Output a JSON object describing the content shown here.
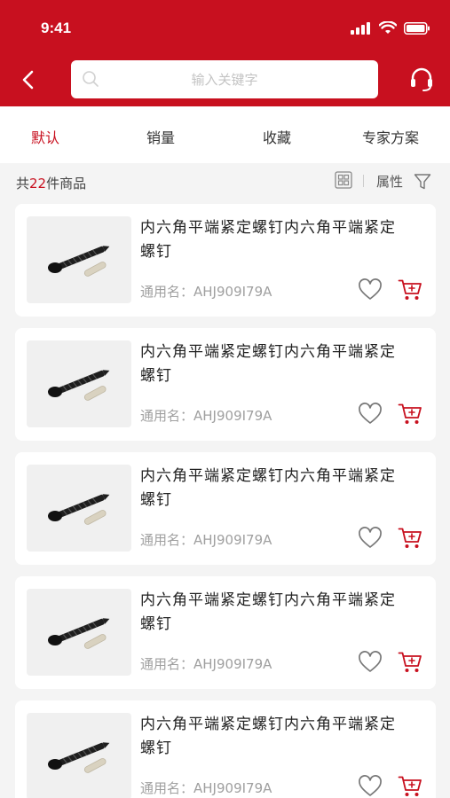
{
  "status": {
    "time": "9:41"
  },
  "search": {
    "placeholder": "输入关键字"
  },
  "tabs": [
    {
      "label": "默认",
      "active": true
    },
    {
      "label": "销量",
      "active": false
    },
    {
      "label": "收藏",
      "active": false
    },
    {
      "label": "专家方案",
      "active": false
    }
  ],
  "summary": {
    "prefix": "共",
    "count": "22",
    "suffix": "件商品",
    "attr_label": "属性"
  },
  "products": [
    {
      "title": "内六角平端紧定螺钉内六角平端紧定螺钉",
      "generic_label": "通用名：",
      "generic_value": "AHJ909I79A"
    },
    {
      "title": "内六角平端紧定螺钉内六角平端紧定螺钉",
      "generic_label": "通用名：",
      "generic_value": "AHJ909I79A"
    },
    {
      "title": "内六角平端紧定螺钉内六角平端紧定螺钉",
      "generic_label": "通用名：",
      "generic_value": "AHJ909I79A"
    },
    {
      "title": "内六角平端紧定螺钉内六角平端紧定螺钉",
      "generic_label": "通用名：",
      "generic_value": "AHJ909I79A"
    },
    {
      "title": "内六角平端紧定螺钉内六角平端紧定螺钉",
      "generic_label": "通用名：",
      "generic_value": "AHJ909I79A"
    }
  ],
  "colors": {
    "brand": "#c8101f",
    "background": "#f4f4f4"
  },
  "icons": [
    "signal-icon",
    "wifi-icon",
    "battery-icon",
    "back-arrow-icon",
    "search-icon",
    "headset-icon",
    "grid-view-icon",
    "filter-icon",
    "heart-icon",
    "cart-icon"
  ]
}
